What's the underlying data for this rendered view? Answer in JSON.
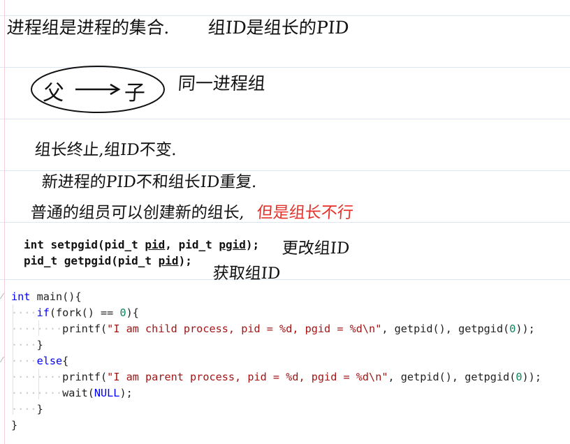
{
  "notes": {
    "line1_left": "进程组是进程的集合.",
    "line1_right": "组ID是组长的PID",
    "parent": "父",
    "child": "子",
    "same_group": "同一进程组",
    "leader_end": "组长终止,组ID不变.",
    "new_pid": "新进程的PID不和组长ID重复.",
    "member_new": "普通的组员可以创建新的组长,",
    "member_new_red": "但是组长不行"
  },
  "signatures": {
    "set_prefix": "int setpgid(pid_t ",
    "set_arg1": "pid",
    "set_mid": ", pid_t ",
    "set_arg2": "pgid",
    "set_suffix": ");",
    "set_note": "更改组ID",
    "get_prefix": "pid_t getpgid(pid_t ",
    "get_arg1": "pid",
    "get_suffix": ");",
    "get_note": "获取组ID"
  },
  "code": {
    "l1_kw": "int",
    "l1_rest": " main(){",
    "l2_kw": "if",
    "l2_a": "(fork() == ",
    "l2_num": "0",
    "l2_b": "){",
    "l3_a": "printf(",
    "l3_str": "\"I am child process, pid = %d, pgid = %d\\n\"",
    "l3_b": ", getpid(), getpgid(",
    "l3_num": "0",
    "l3_c": "));",
    "l4": "}",
    "l5_kw": "else",
    "l5_rest": "{",
    "l6_a": "printf(",
    "l6_str": "\"I am parent process, pid = %d, pgid = %d\\n\"",
    "l6_b": ", getpid(), getpgid(",
    "l6_num": "0",
    "l6_c": "));",
    "l7_a": "wait(",
    "l7_kw": "NULL",
    "l7_b": ");",
    "l8": "}",
    "l9": "}"
  }
}
